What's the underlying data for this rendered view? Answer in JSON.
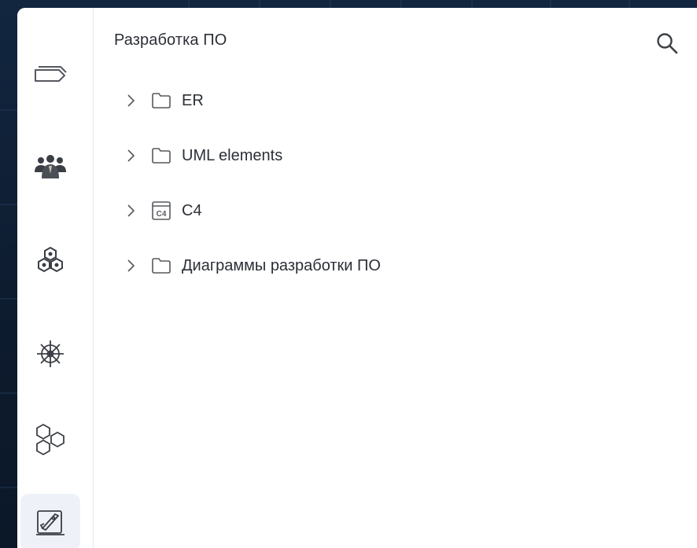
{
  "header": {
    "title": "Разработка ПО"
  },
  "search": {
    "icon": "search-icon"
  },
  "rail": {
    "items": [
      {
        "icon": "tags-icon"
      },
      {
        "icon": "people-group-icon"
      },
      {
        "icon": "cluster-icon"
      },
      {
        "icon": "ship-wheel-icon"
      },
      {
        "icon": "hexagons-icon"
      },
      {
        "icon": "rocket-board-icon",
        "active": true
      }
    ]
  },
  "tree": {
    "items": [
      {
        "label": "ER",
        "icon": "folder-icon"
      },
      {
        "label": "UML elements",
        "icon": "folder-icon"
      },
      {
        "label": "C4",
        "icon": "c4-model-icon"
      },
      {
        "label": "Диаграммы разработки ПО",
        "icon": "folder-icon"
      }
    ]
  },
  "colors": {
    "text": "#2b2f36",
    "icon": "#55595f",
    "rail_active": "#eef2f8",
    "background": "#0f1e33"
  }
}
